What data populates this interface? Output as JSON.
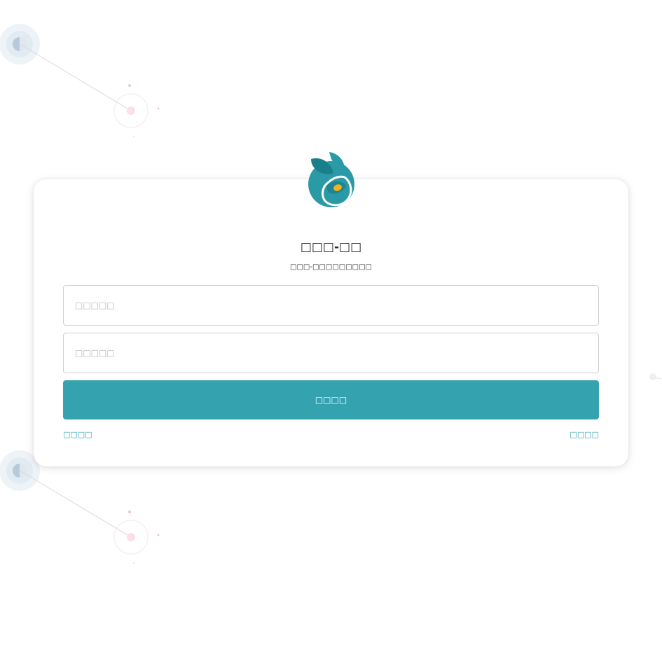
{
  "login": {
    "title": "□□□-□□",
    "subtitle": "□□□-□□□□□□□□□",
    "username_placeholder": "□□□□□",
    "password_placeholder": "□□□□□",
    "submit_label": "□□□□",
    "left_link": "□□□□",
    "right_link": "□□□□"
  },
  "colors": {
    "accent": "#35a2b0",
    "logo_teal": "#1f8f9c",
    "logo_eye": "#f3b31a"
  },
  "icons": {
    "logo": "rabbit-logo-icon"
  }
}
